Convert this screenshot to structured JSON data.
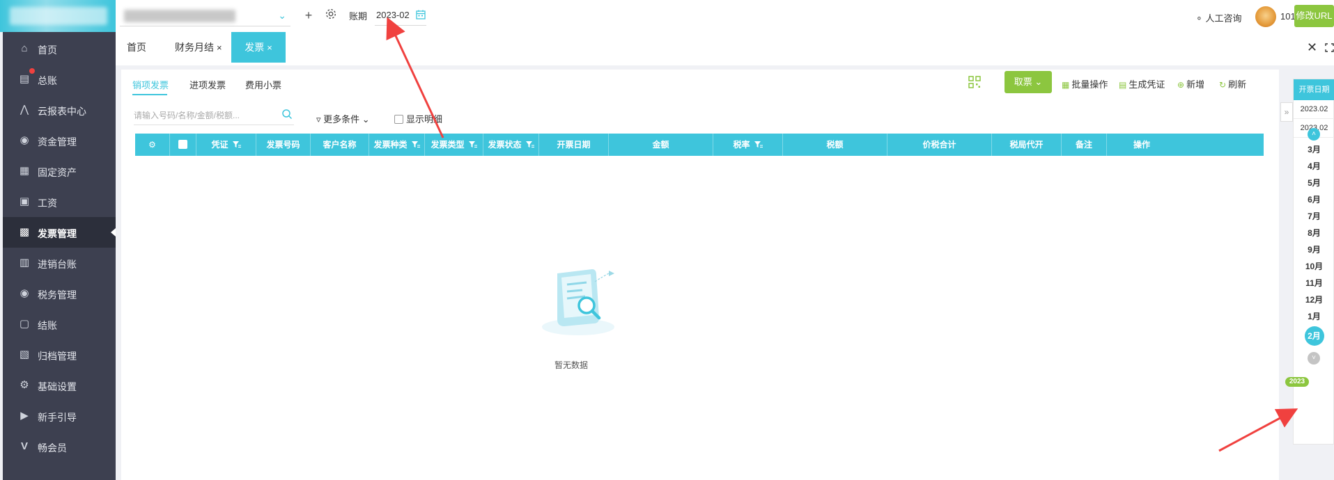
{
  "topbar": {
    "period_label": "账期",
    "period_value": "2023-02",
    "consult_label": "人工咨询",
    "user_id": "101",
    "modify_url_label": "修改URL"
  },
  "sidebar": {
    "items": [
      {
        "label": "首页",
        "icon": "home-icon"
      },
      {
        "label": "总账",
        "icon": "ledger-icon"
      },
      {
        "label": "云报表中心",
        "icon": "chart-icon"
      },
      {
        "label": "资金管理",
        "icon": "money-bag-icon"
      },
      {
        "label": "固定资产",
        "icon": "asset-icon"
      },
      {
        "label": "工资",
        "icon": "salary-icon"
      },
      {
        "label": "发票管理",
        "icon": "invoice-icon",
        "active": true
      },
      {
        "label": "进销台账",
        "icon": "inventory-icon"
      },
      {
        "label": "税务管理",
        "icon": "tax-icon"
      },
      {
        "label": "结账",
        "icon": "checkout-icon"
      },
      {
        "label": "归档管理",
        "icon": "archive-icon"
      },
      {
        "label": "基础设置",
        "icon": "gear-icon"
      },
      {
        "label": "新手引导",
        "icon": "guide-icon"
      },
      {
        "label": "畅会员",
        "icon": "vip-icon"
      }
    ]
  },
  "tabs": [
    {
      "label": "首页"
    },
    {
      "label": "财务月结",
      "close": "×"
    },
    {
      "label": "发票",
      "close": "×",
      "active": true
    }
  ],
  "subtabs": [
    {
      "label": "销项发票",
      "active": true
    },
    {
      "label": "进项发票"
    },
    {
      "label": "费用小票"
    }
  ],
  "toolbar": {
    "fetch_label": "取票",
    "batch_label": "批量操作",
    "voucher_label": "生成凭证",
    "add_label": "新增",
    "refresh_label": "刷新"
  },
  "search": {
    "placeholder": "请输入号码/名称/金额/税额...",
    "value": ""
  },
  "filters": {
    "more_label": "更多条件",
    "show_detail_label": "显示明细"
  },
  "grid": {
    "columns": [
      "凭证",
      "发票号码",
      "客户名称",
      "发票种类",
      "发票类型",
      "发票状态",
      "开票日期",
      "金额",
      "税率",
      "税额",
      "价税合计",
      "税局代开",
      "备注",
      "操作"
    ],
    "rows": [],
    "empty_text": "暂无数据"
  },
  "rail": {
    "header": "开票日期",
    "dates": [
      "2023.02",
      "2023.02"
    ],
    "months": [
      "3月",
      "4月",
      "5月",
      "6月",
      "7月",
      "8月",
      "9月",
      "10月",
      "11月",
      "12月",
      "1月",
      "2月"
    ],
    "year_badge": "2023",
    "selected_month": "2月"
  },
  "colors": {
    "accent": "#3ec5dc",
    "green": "#8cc63f",
    "sidebar_bg": "#3d4050",
    "annotation_arrow": "#f0413f"
  }
}
